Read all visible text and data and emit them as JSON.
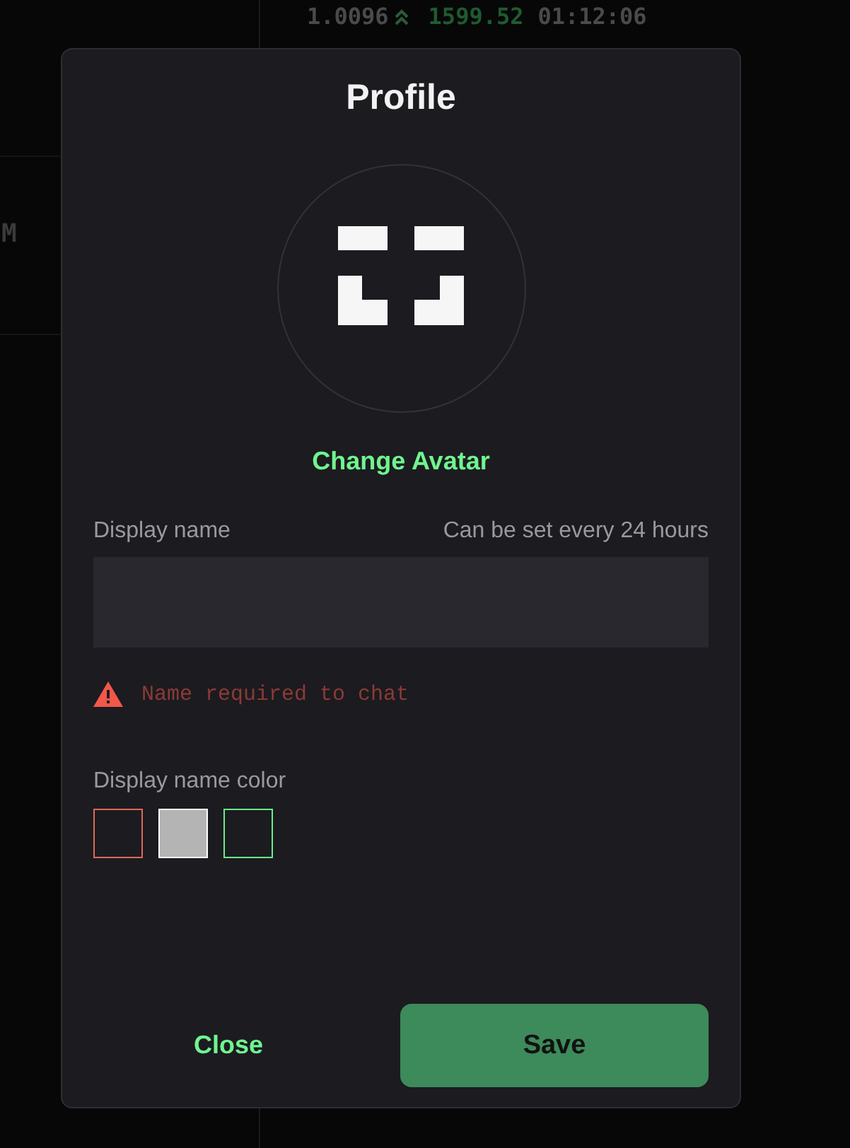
{
  "background": {
    "side_text": "M",
    "ticker_row": {
      "price": "1.0096",
      "value": "1599.52",
      "time": "01:12:06"
    }
  },
  "modal": {
    "title": "Profile",
    "change_avatar": "Change Avatar",
    "display_name": {
      "label": "Display name",
      "hint": "Can be set every 24 hours",
      "error": "Name required to chat"
    },
    "color_label": "Display name color",
    "swatches": [
      {
        "color": "#e0685a",
        "selected": false
      },
      {
        "color": "#b4b4b4",
        "selected": true
      },
      {
        "color": "#66f08a",
        "selected": false
      }
    ],
    "buttons": {
      "close": "Close",
      "save": "Save"
    }
  }
}
